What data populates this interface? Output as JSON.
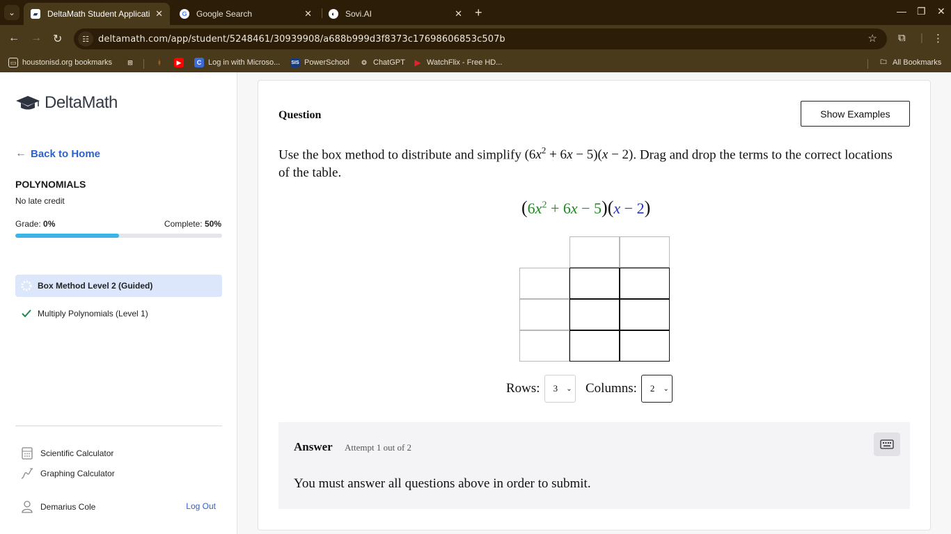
{
  "browser": {
    "tabs": [
      {
        "title": "DeltaMath Student Application",
        "active": true
      },
      {
        "title": "Google Search",
        "active": false
      },
      {
        "title": "Sovi.AI",
        "active": false
      }
    ],
    "url": "deltamath.com/app/student/5248461/30939908/a688b999d3f8373c17698606853c507b",
    "bookmarks": [
      {
        "label": "houstonisd.org bookmarks"
      },
      {
        "label": "Log in with Microso..."
      },
      {
        "label": "PowerSchool"
      },
      {
        "label": "ChatGPT"
      },
      {
        "label": "WatchFlix - Free HD..."
      }
    ],
    "all_bookmarks": "All Bookmarks"
  },
  "sidebar": {
    "logo": "DeltaMath",
    "back_home": "Back to Home",
    "assignment_title": "POLYNOMIALS",
    "late_credit": "No late credit",
    "grade_label": "Grade:",
    "grade_value": "0%",
    "complete_label": "Complete:",
    "complete_value": "50%",
    "complete_fraction": 0.5,
    "skills": [
      {
        "label": "Box Method Level 2 (Guided)",
        "status": "in-progress"
      },
      {
        "label": "Multiply Polynomials (Level 1)",
        "status": "complete"
      }
    ],
    "tools": [
      {
        "label": "Scientific Calculator"
      },
      {
        "label": "Graphing Calculator"
      }
    ],
    "user_name": "Demarius Cole",
    "logout": "Log Out"
  },
  "main": {
    "question_label": "Question",
    "show_examples": "Show Examples",
    "question_text_before": "Use the box method to distribute and simplify",
    "question_text_after": ". Drag and drop the terms to the correct locations of the table.",
    "rows_label": "Rows:",
    "rows_value": "3",
    "columns_label": "Columns:",
    "columns_value": "2",
    "answer_label": "Answer",
    "attempt_text": "Attempt 1 out of 2",
    "must_answer": "You must answer all questions above in order to submit."
  },
  "colors": {
    "accent_blue": "#2a63c9",
    "progress": "#3bb4e8",
    "green_term": "#1f8a1f",
    "blue_term": "#2233cc",
    "chrome_dark": "#2b1d07",
    "chrome_mid": "#4a3a1c"
  }
}
